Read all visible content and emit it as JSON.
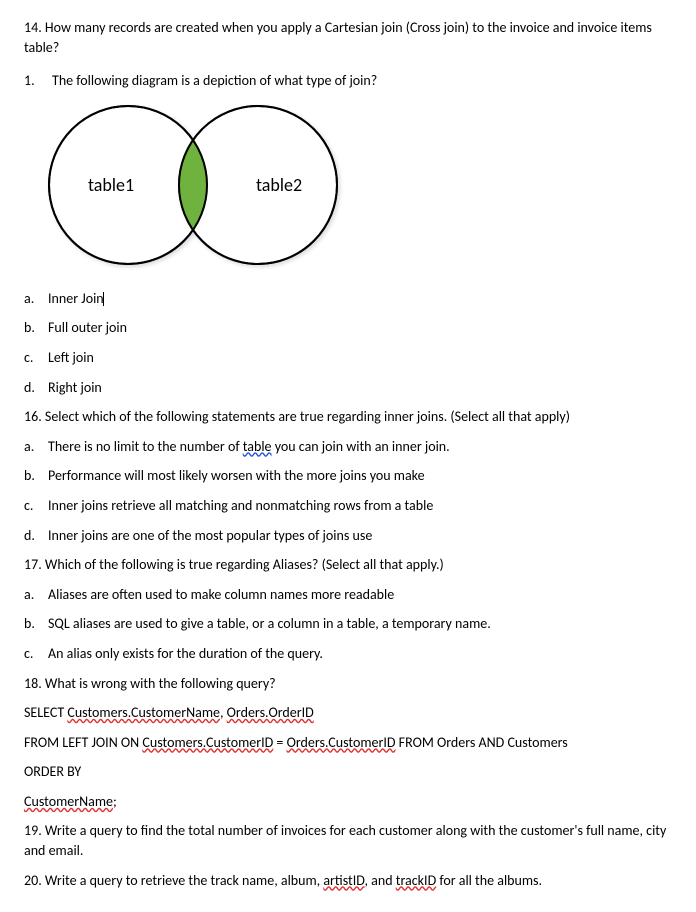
{
  "q14": "14.  How many records are created when you apply a Cartesian join (Cross join) to the invoice and invoice items table?",
  "q14_sub1_num": "1.",
  "q14_sub1_text": "The following diagram is a depiction of what type of join?",
  "venn": {
    "left": "table1",
    "right": "table2"
  },
  "q14_opts": {
    "a": {
      "l": "a.",
      "t": "Inner Join"
    },
    "b": {
      "l": "b.",
      "t": "Full outer join"
    },
    "c": {
      "l": "c.",
      "t": "Left join"
    },
    "d": {
      "l": "d.",
      "t": "Right join"
    }
  },
  "q16": "16.  Select which of the following statements are true regarding inner joins. (Select all that apply)",
  "q16_opts": {
    "a": {
      "l": "a.",
      "pre": "There is no limit to the number of ",
      "u": "table",
      "post": " you can join with an inner join."
    },
    "b": {
      "l": "b.",
      "t": "Performance will most likely worsen with the more joins you make"
    },
    "c": {
      "l": "c.",
      "t": "Inner joins retrieve all matching and nonmatching rows from a table"
    },
    "d": {
      "l": "d.",
      "t": "Inner joins are one of the most popular types of joins use"
    }
  },
  "q17": "17.  Which of the following is true regarding Aliases? (Select all that apply.)",
  "q17_opts": {
    "a": {
      "l": " a.",
      "t": "Aliases are often used to make column names more readable"
    },
    "b": {
      "l": "b.",
      "t": "SQL aliases are used to give a table, or a column in a table, a temporary name."
    },
    "c": {
      "l": "c.",
      "t": "An alias only exists for the duration of the query."
    }
  },
  "q18": "18. What is wrong with the following query?",
  "q18_sql": {
    "line1_pre": "SELECT ",
    "line1_u1": "Customers.CustomerName",
    "line1_mid": ", ",
    "line1_u2": "Orders.OrderID",
    "line2_pre": "FROM LEFT JOIN ON ",
    "line2_u1": "Customers.CustomerID",
    "line2_mid": " = ",
    "line2_u2": "Orders.CustomerID",
    "line2_post": " FROM Orders AND Customers",
    "line3": "ORDER BY",
    "line4_u": "CustomerName",
    "line4_post": ";"
  },
  "q19": "19.  Write a query to find the total number of invoices for each customer along with the customer's full name, city and email.",
  "q20_pre": "20.  Write a query to retrieve the track name, album, ",
  "q20_u1": "artistID",
  "q20_mid": ", and ",
  "q20_u2": "trackID",
  "q20_post": " for all the albums."
}
